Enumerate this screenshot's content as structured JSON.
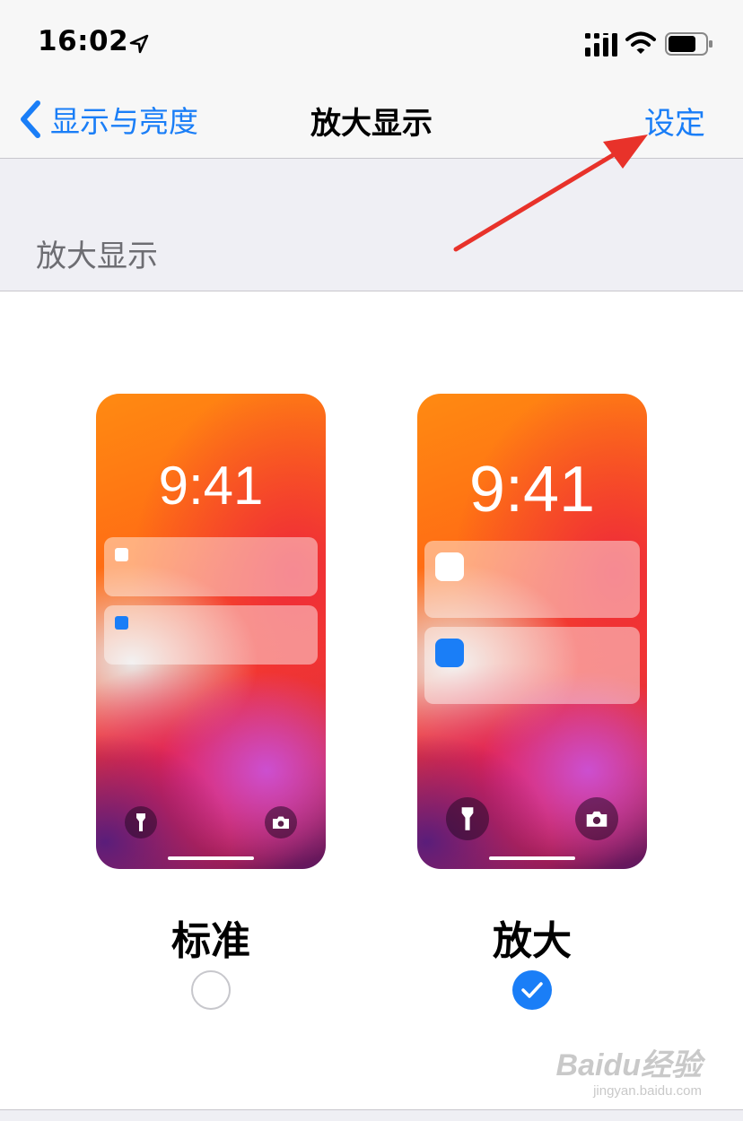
{
  "status_bar": {
    "time": "16:02"
  },
  "nav": {
    "back_label": "显示与亮度",
    "title": "放大显示",
    "action_label": "设定"
  },
  "section_header": "放大显示",
  "options": [
    {
      "label": "标准",
      "time": "9:41",
      "selected": false
    },
    {
      "label": "放大",
      "time": "9:41",
      "selected": true
    }
  ],
  "watermark": {
    "brand": "Baidu经验",
    "url": "jingyan.baidu.com"
  },
  "colors": {
    "accent": "#1a7ef7",
    "annotation_arrow": "#e8322a"
  }
}
